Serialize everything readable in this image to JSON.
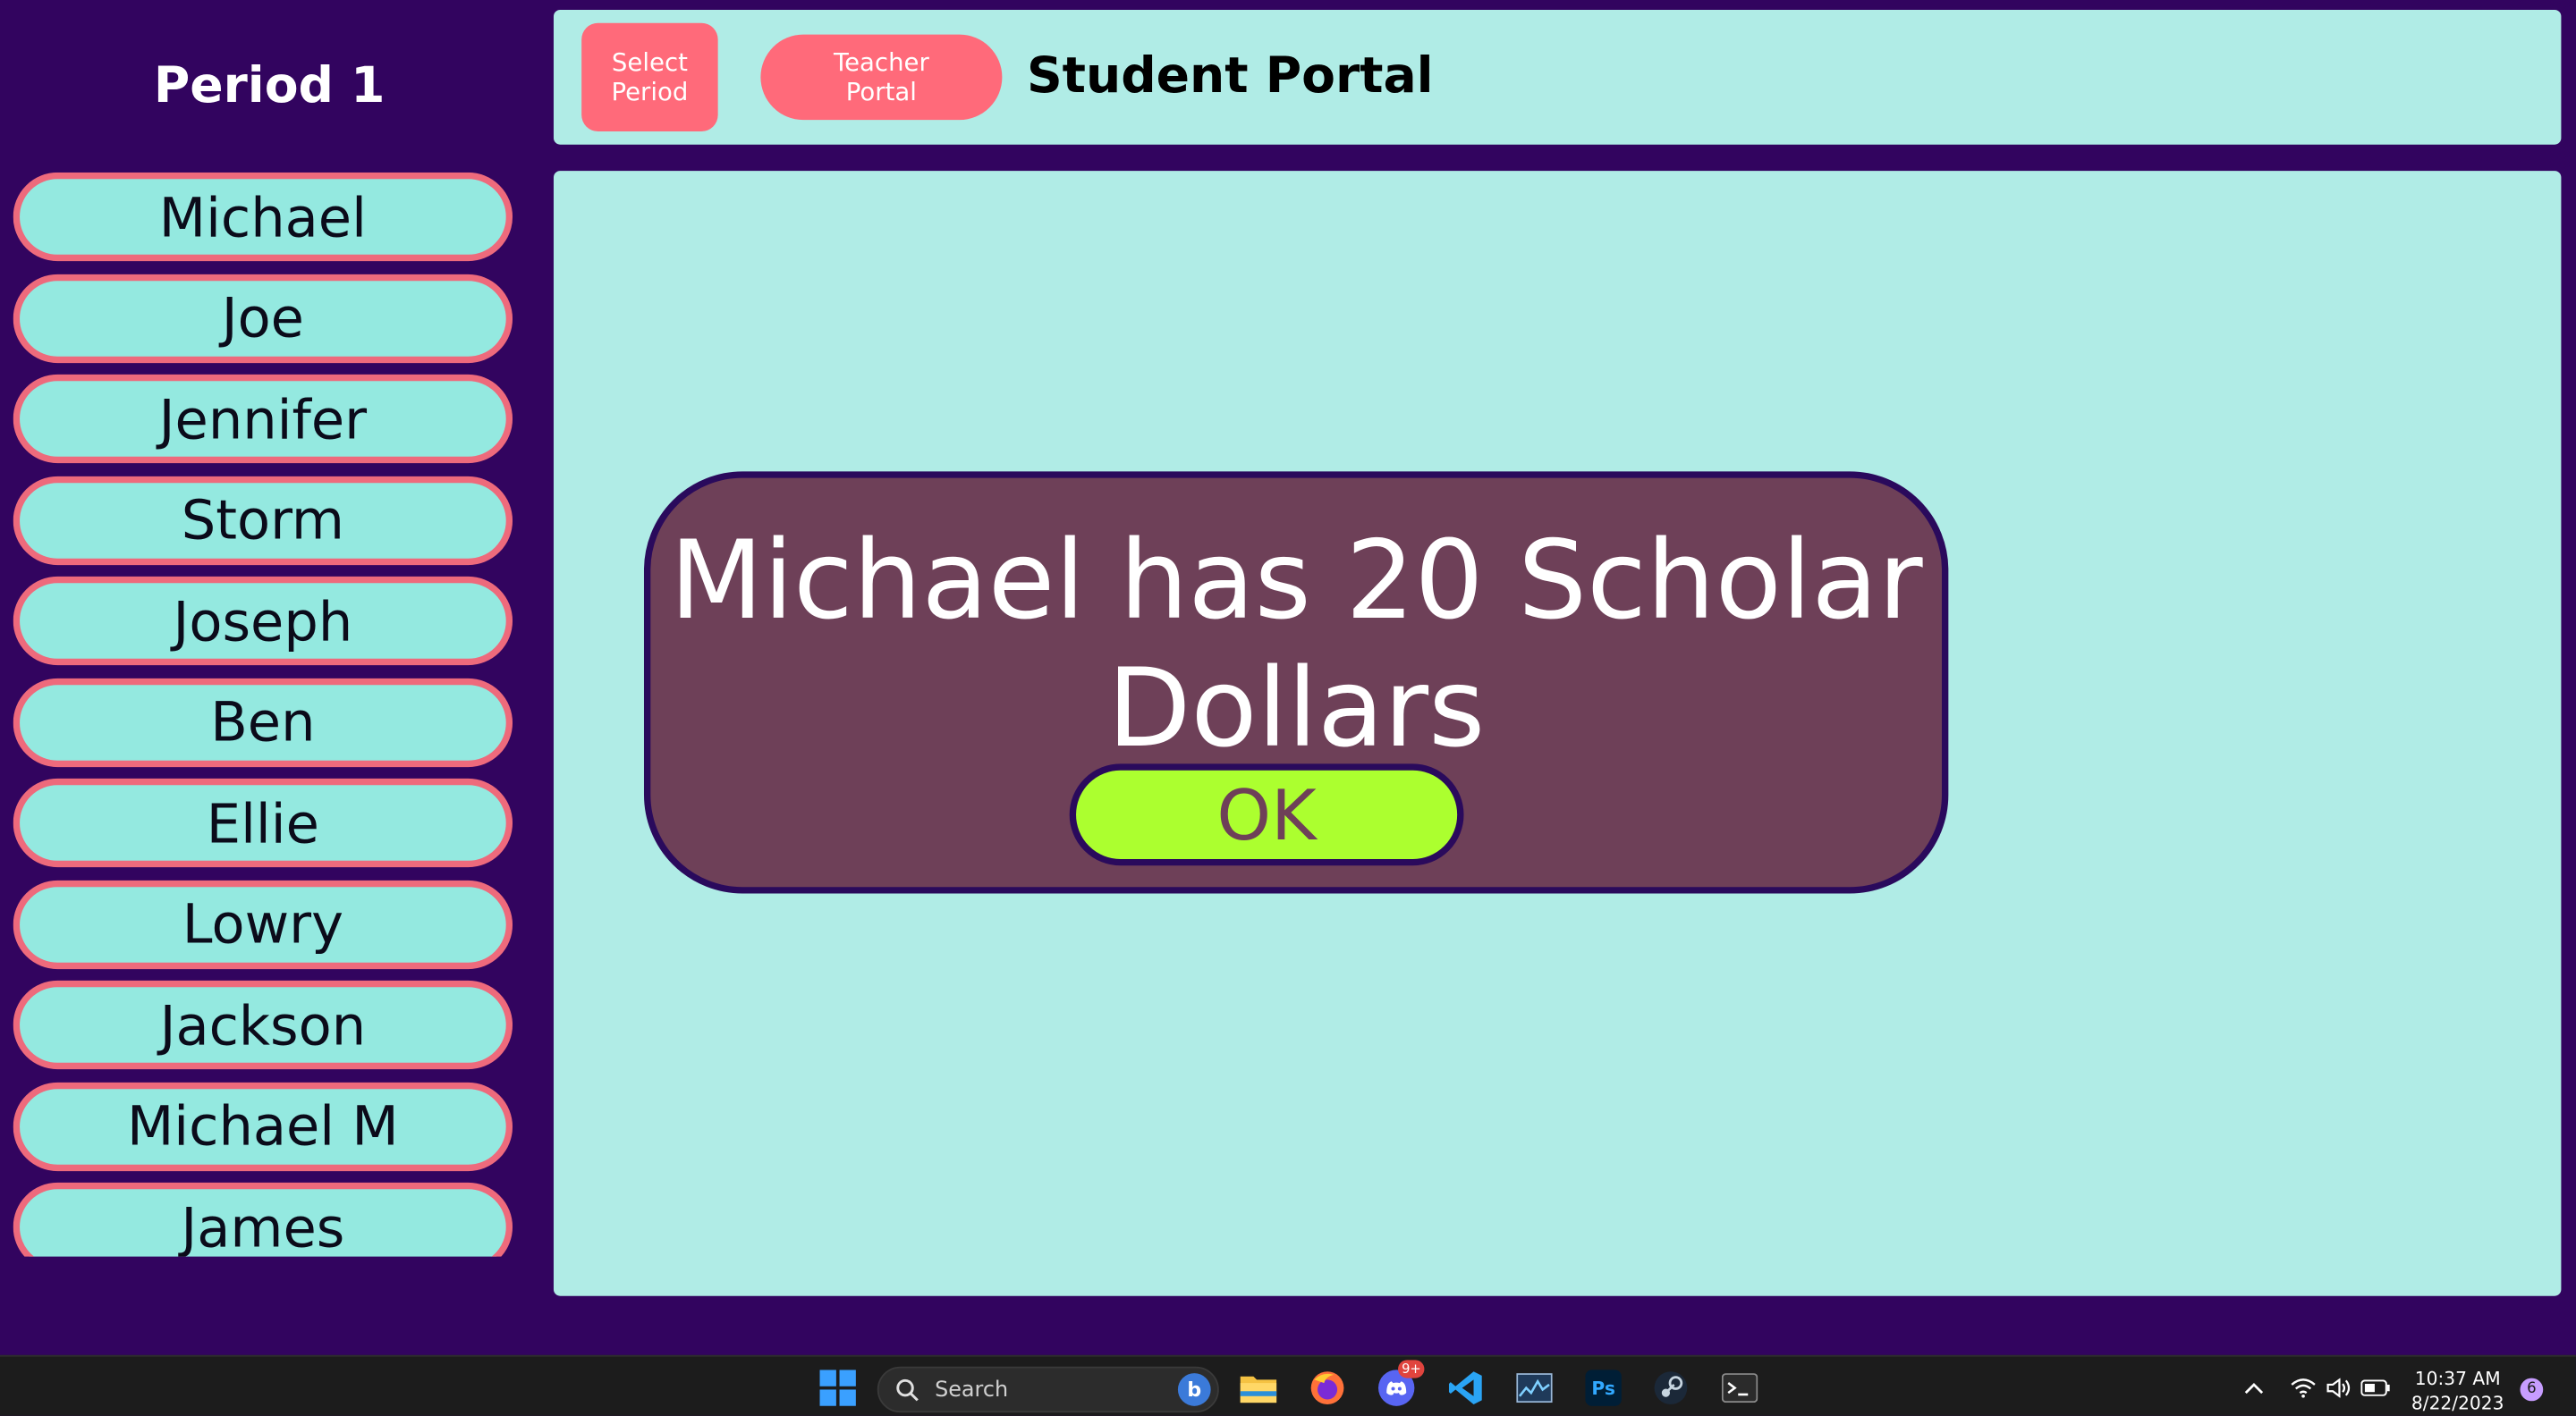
{
  "sidebar": {
    "period_title": "Period 1",
    "students": [
      {
        "name": "Michael"
      },
      {
        "name": "Joe"
      },
      {
        "name": "Jennifer"
      },
      {
        "name": "Storm"
      },
      {
        "name": "Joseph"
      },
      {
        "name": "Ben"
      },
      {
        "name": "Ellie"
      },
      {
        "name": "Lowry"
      },
      {
        "name": "Jackson"
      },
      {
        "name": "Michael M"
      },
      {
        "name": "James"
      }
    ]
  },
  "header": {
    "select_period_line1": "Select",
    "select_period_line2": "Period",
    "teacher_portal_line1": "Teacher",
    "teacher_portal_line2": "Portal",
    "title": "Student Portal"
  },
  "dialog": {
    "message_line1": "Michael has 20 Scholar",
    "message_line2": "Dollars",
    "ok_label": "OK"
  },
  "taskbar": {
    "search_label": "Search",
    "discord_badge": "9+",
    "time": "10:37 AM",
    "date": "8/22/2023",
    "notification_count": "6"
  },
  "colors": {
    "background": "#32045f",
    "panel": "#b0ece6",
    "student_button": "#94e9e0",
    "student_border": "#ee6a7c",
    "header_button": "#ff6a7a",
    "dialog": "#6e4058",
    "ok_button": "#acff2f"
  }
}
